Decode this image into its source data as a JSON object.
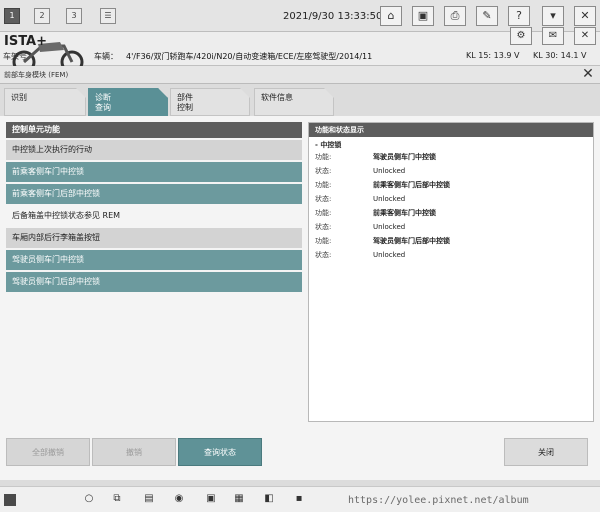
{
  "topbar": {
    "tabs": [
      "1",
      "2",
      "3"
    ],
    "datetime": "2021/9/30 13:33:50"
  },
  "header": {
    "app_title": "ISTA+",
    "vehicle_label": "车辆：",
    "vehicle_value": "4'/F36/双门轿跑车/420i/N20/自动变速箱/ECE/左座驾驶型/2014/11",
    "cheliang_label": "车架号",
    "kl15": "KL 15:  13.9 V",
    "kl30": "KL 30:  14.1 V"
  },
  "module": {
    "title": "前部车身模块 (FEM)"
  },
  "tabs": [
    {
      "label": "识别"
    },
    {
      "label": "诊断\n查询"
    },
    {
      "label": "部件\n控制"
    },
    {
      "label": "软件信息"
    }
  ],
  "left_panel": {
    "header": "控制单元功能",
    "items": [
      {
        "label": "中控锁上次执行的行动",
        "style": "gray"
      },
      {
        "label": "前乘客侧车门中控锁",
        "style": "teal"
      },
      {
        "label": "前乘客侧车门后部中控锁",
        "style": "teal"
      },
      {
        "label": "后备箱盖中控锁状态参见 REM",
        "style": "white"
      },
      {
        "label": "车厢内部后行李箱盖按钮",
        "style": "gray"
      },
      {
        "label": "驾驶员侧车门中控锁",
        "style": "teal"
      },
      {
        "label": "驾驶员侧车门后部中控锁",
        "style": "teal"
      }
    ]
  },
  "right_panel": {
    "header": "功能和状态显示",
    "group": "- 中控锁",
    "rows": [
      {
        "func_label": "功能:",
        "func": "驾驶员侧车门中控锁",
        "status_label": "状态:",
        "status": "Unlocked"
      },
      {
        "func_label": "功能:",
        "func": "前乘客侧车门后部中控锁",
        "status_label": "状态:",
        "status": "Unlocked"
      },
      {
        "func_label": "功能:",
        "func": "前乘客侧车门中控锁",
        "status_label": "状态:",
        "status": "Unlocked"
      },
      {
        "func_label": "功能:",
        "func": "驾驶员侧车门后部中控锁",
        "status_label": "状态:",
        "status": "Unlocked"
      }
    ]
  },
  "buttons": {
    "all_cancel": "全部撤销",
    "cancel": "撤销",
    "query_status": "查询状态",
    "close": "关闭"
  },
  "watermark": "https://yolee.pixnet.net/album"
}
